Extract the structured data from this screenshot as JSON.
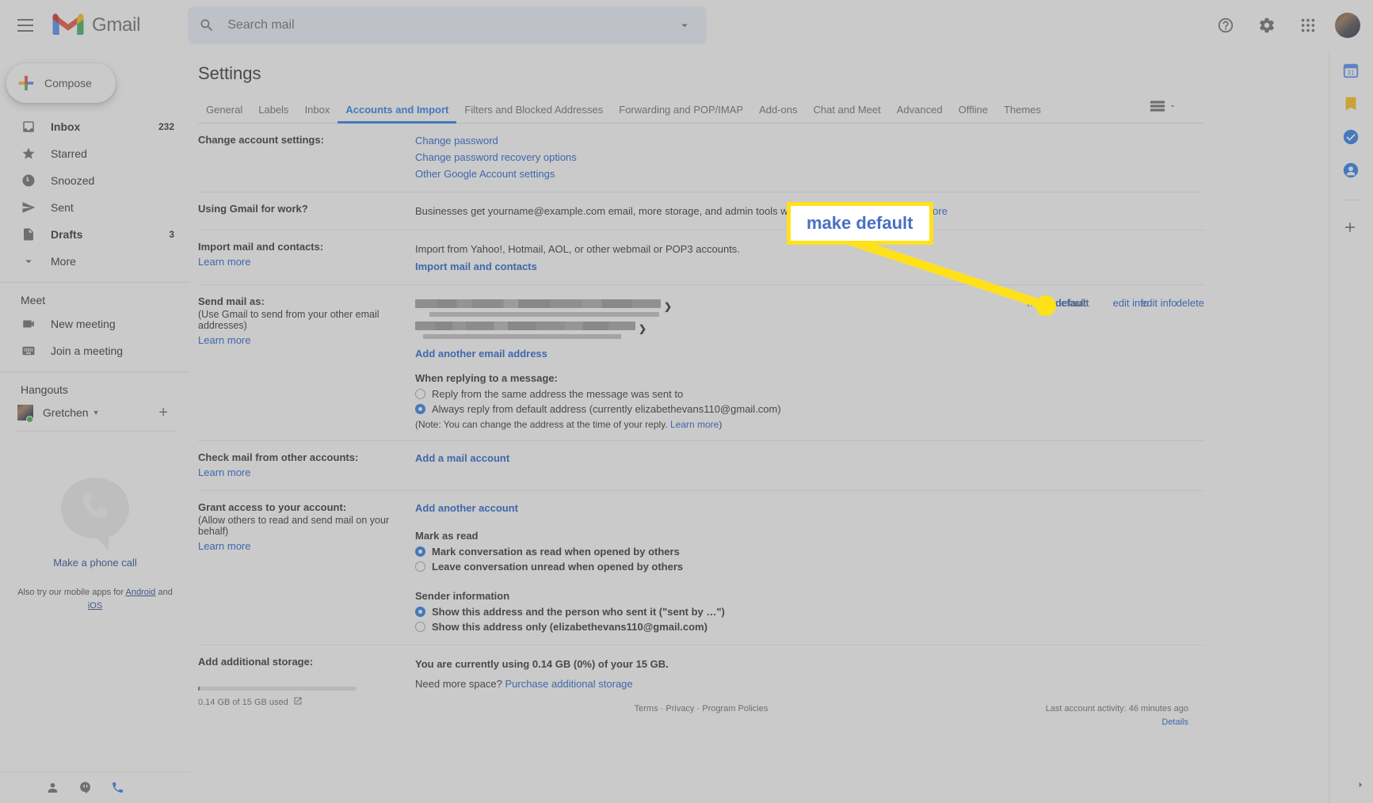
{
  "topbar": {
    "menu_icon": "hamburger-icon",
    "logo_text": "Gmail",
    "search_placeholder": "Search mail",
    "search_value": "",
    "search_icon": "search-icon",
    "filter_icon": "filter-options-icon",
    "help_icon": "help-icon",
    "settings_icon": "gear-icon",
    "apps_icon": "apps-grid-icon",
    "avatar": "user-avatar"
  },
  "sidebar": {
    "compose_label": "Compose",
    "items": [
      {
        "label": "Inbox",
        "count": "232",
        "icon": "inbox-icon",
        "bold": true
      },
      {
        "label": "Starred",
        "count": "",
        "icon": "star-icon",
        "bold": false
      },
      {
        "label": "Snoozed",
        "count": "",
        "icon": "clock-icon",
        "bold": false
      },
      {
        "label": "Sent",
        "count": "",
        "icon": "send-icon",
        "bold": false
      },
      {
        "label": "Drafts",
        "count": "3",
        "icon": "draft-icon",
        "bold": true
      },
      {
        "label": "More",
        "count": "",
        "icon": "chevron-down-icon",
        "bold": false
      }
    ],
    "meet": {
      "title": "Meet",
      "items": [
        {
          "label": "New meeting",
          "icon": "video-camera-icon"
        },
        {
          "label": "Join a meeting",
          "icon": "keyboard-icon"
        }
      ]
    },
    "hangouts": {
      "title": "Hangouts",
      "contact_name": "Gretchen",
      "status": "online",
      "status_color": "#34a853",
      "add_icon": "plus-icon",
      "make_call_label": "Make a phone call",
      "apps_prefix": "Also try our mobile apps for",
      "apps_android": "Android",
      "apps_and": "and",
      "apps_ios": "iOS"
    },
    "bottom_icons": [
      {
        "name": "contacts-icon"
      },
      {
        "name": "hangouts-chat-icon"
      },
      {
        "name": "phone-icon"
      }
    ]
  },
  "main": {
    "page_title": "Settings",
    "density_icon": "display-density-icon",
    "tabs": [
      {
        "label": "General",
        "active": false
      },
      {
        "label": "Labels",
        "active": false
      },
      {
        "label": "Inbox",
        "active": false
      },
      {
        "label": "Accounts and Import",
        "active": true
      },
      {
        "label": "Filters and Blocked Addresses",
        "active": false
      },
      {
        "label": "Forwarding and POP/IMAP",
        "active": false
      },
      {
        "label": "Add-ons",
        "active": false
      },
      {
        "label": "Chat and Meet",
        "active": false
      },
      {
        "label": "Advanced",
        "active": false
      },
      {
        "label": "Offline",
        "active": false
      },
      {
        "label": "Themes",
        "active": false
      }
    ],
    "change_account": {
      "label": "Change account settings:",
      "links": [
        "Change password",
        "Change password recovery options",
        "Other Google Account settings"
      ]
    },
    "gmail_for_work": {
      "label": "Using Gmail for work?",
      "text": "Businesses get yourname@example.com email, more storage, and admin tools with Google Workspace.",
      "link": "Learn more"
    },
    "import": {
      "label": "Import mail and contacts:",
      "learn_more": "Learn more",
      "text": "Import from Yahoo!, Hotmail, AOL, or other webmail or POP3 accounts.",
      "link": "Import mail and contacts"
    },
    "send_mail_as": {
      "label": "Send mail as:",
      "sub": "(Use Gmail to send from your other email addresses)",
      "learn_more": "Learn more",
      "rows": [
        {
          "address": "[redacted email address]",
          "default_label": "default",
          "edit_label": "edit info",
          "delete_label": ""
        },
        {
          "address": "[redacted email address]",
          "make_default_label": "make default",
          "edit_label": "edit info",
          "delete_label": "delete"
        }
      ],
      "add_link": "Add another email address",
      "reply_heading": "When replying to a message:",
      "reply_options": [
        {
          "label": "Reply from the same address the message was sent to",
          "selected": false
        },
        {
          "label": "Always reply from default address (currently elizabethevans110@gmail.com)",
          "selected": true
        }
      ],
      "note_prefix": "(Note: You can change the address at the time of your reply.",
      "note_link": "Learn more",
      "note_suffix": ")"
    },
    "check_mail": {
      "label": "Check mail from other accounts:",
      "learn_more": "Learn more",
      "link": "Add a mail account"
    },
    "grant_access": {
      "label": "Grant access to your account:",
      "sub": "(Allow others to read and send mail on your behalf)",
      "learn_more": "Learn more",
      "link": "Add another account",
      "mark_heading": "Mark as read",
      "mark_options": [
        {
          "label": "Mark conversation as read when opened by others",
          "selected": true
        },
        {
          "label": "Leave conversation unread when opened by others",
          "selected": false
        }
      ],
      "sender_heading": "Sender information",
      "sender_options": [
        {
          "label": "Show this address and the person who sent it (\"sent by …\")",
          "selected": true
        },
        {
          "label": "Show this address only (elizabethevans110@gmail.com)",
          "selected": false
        }
      ]
    },
    "storage": {
      "label": "Add additional storage:",
      "usage_text": "You are currently using 0.14 GB (0%) of your 15 GB.",
      "need_more": "Need more space?",
      "purchase_link": "Purchase additional storage"
    }
  },
  "footer": {
    "storage_used_text": "0.14 GB of 15 GB used",
    "open_icon": "open-in-new-icon",
    "terms": "Terms",
    "privacy": "Privacy",
    "policies": "Program Policies",
    "separator": "·",
    "activity": "Last account activity: 46 minutes ago",
    "details": "Details"
  },
  "rail": {
    "icons": [
      {
        "name": "google-calendar-icon"
      },
      {
        "name": "google-keep-icon"
      },
      {
        "name": "google-tasks-icon"
      },
      {
        "name": "google-contacts-icon"
      },
      {
        "name": "add-addon-icon"
      }
    ],
    "expand_icon": "expand-panel-icon"
  },
  "annotation": {
    "callout_text": "make default",
    "border_color": "#ffe11a",
    "text_color": "#4a6fc4",
    "arrow_color": "#ffe11a"
  }
}
